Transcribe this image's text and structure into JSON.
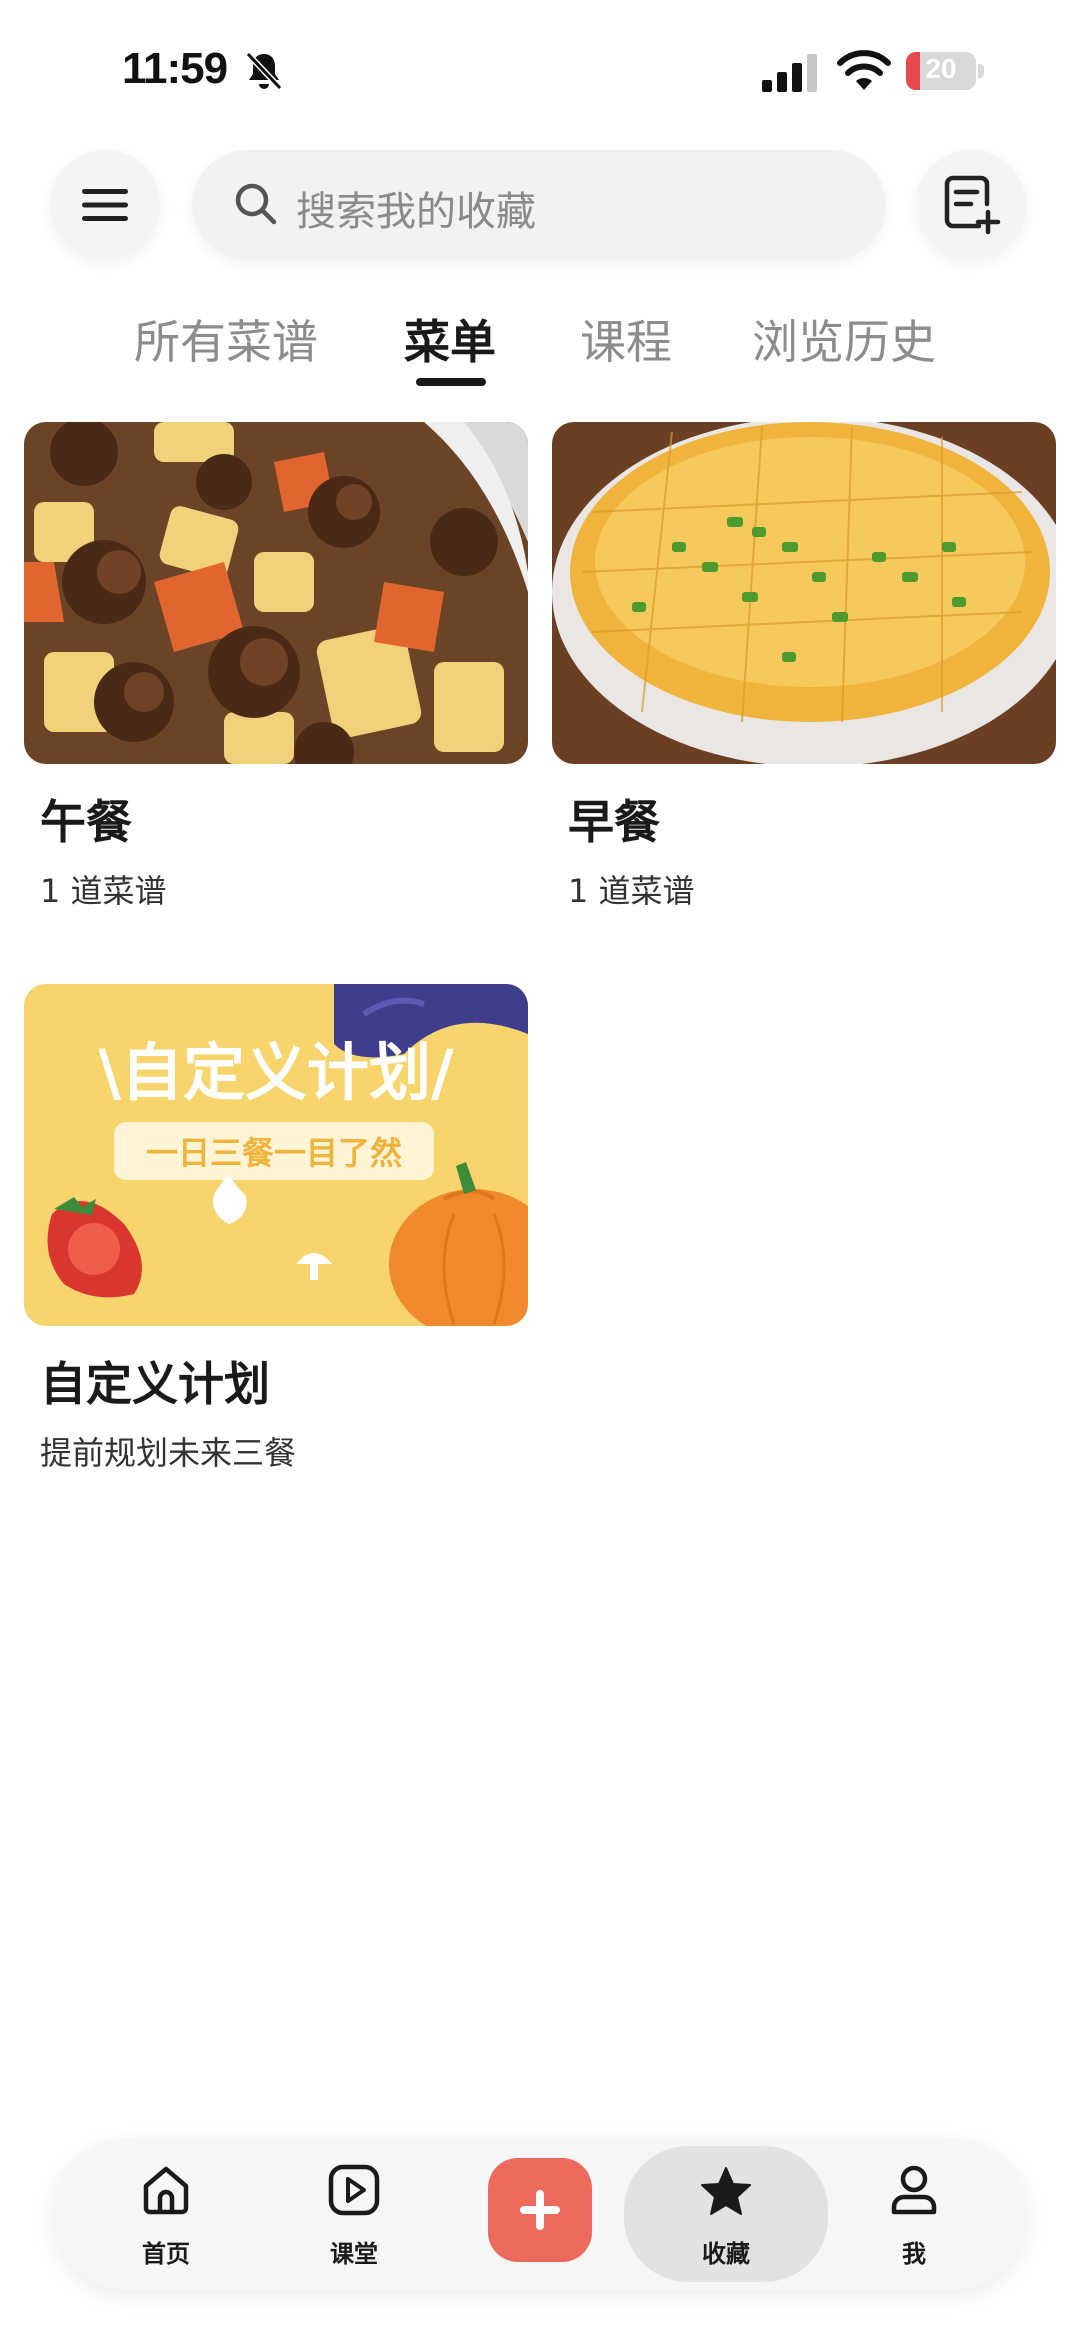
{
  "status_bar": {
    "time": "11:59",
    "battery_level": "20",
    "battery_color": "#e5484d"
  },
  "header": {
    "menu_icon": "hamburger-menu-icon",
    "search_placeholder": "搜索我的收藏",
    "new_list_icon": "note-add-icon"
  },
  "tabs": [
    {
      "label": "所有菜谱",
      "active": false
    },
    {
      "label": "菜单",
      "active": true
    },
    {
      "label": "课程",
      "active": false
    },
    {
      "label": "浏览历史",
      "active": false
    }
  ],
  "cards": [
    {
      "title": "午餐",
      "subtitle": "1 道菜谱",
      "image": "beef-potato-stew-photo"
    },
    {
      "title": "早餐",
      "subtitle": "1 道菜谱",
      "image": "steamed-egg-custard-photo"
    },
    {
      "title": "自定义计划",
      "subtitle": "提前规划未来三餐",
      "image": "custom-plan-banner",
      "banner_title": "\\自定义计划/",
      "banner_tagline": "一日三餐一目了然"
    }
  ],
  "bottom_nav": [
    {
      "label": "首页",
      "icon": "home-icon"
    },
    {
      "label": "课堂",
      "icon": "play-icon"
    },
    {
      "label": "",
      "icon": "plus-icon"
    },
    {
      "label": "收藏",
      "icon": "star-icon",
      "active": true
    },
    {
      "label": "我",
      "icon": "person-icon"
    }
  ],
  "colors": {
    "accent": "#ec6a5b",
    "banner_yellow": "#f7d56c"
  }
}
